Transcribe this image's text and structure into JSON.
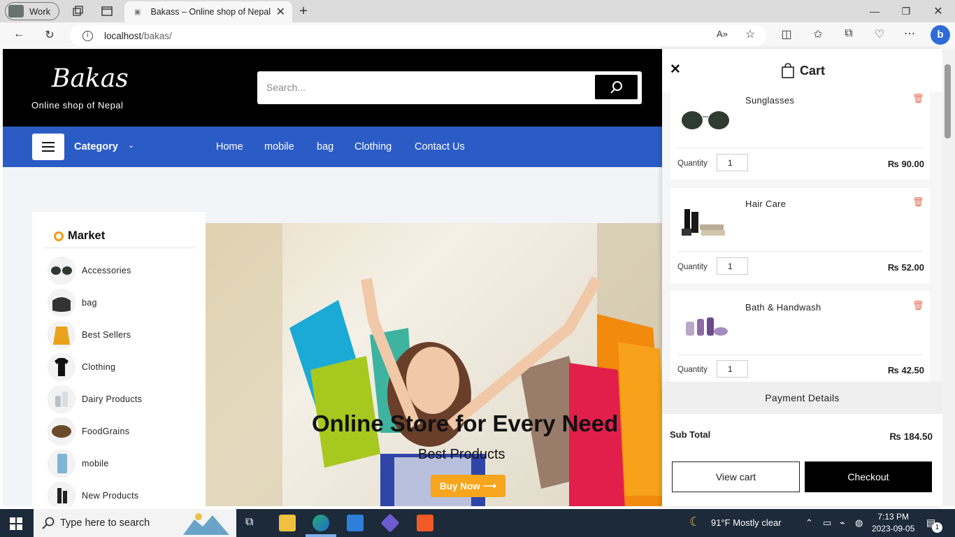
{
  "browser": {
    "profile_label": "Work",
    "tab_title": "Bakass – Online shop of Nepal",
    "url_host": "localhost",
    "url_path": "/bakas/"
  },
  "site": {
    "logo": "Bakas",
    "tagline": "Online shop of Nepal",
    "search_placeholder": "Search...",
    "category_label": "Category",
    "nav": [
      "Home",
      "mobile",
      "bag",
      "Clothing",
      "Contact Us"
    ]
  },
  "market": {
    "title": "Market",
    "items": [
      "Accessories",
      "bag",
      "Best Sellers",
      "Clothing",
      "Dairy Products",
      "FoodGrains",
      "mobile",
      "New Products"
    ]
  },
  "hero": {
    "title": "Online Store for Every Need",
    "subtitle": "Best Products",
    "button": "Buy Now"
  },
  "cart": {
    "title": "Cart",
    "quantity_label": "Quantity",
    "items": [
      {
        "name": "Sunglasses",
        "qty": "1",
        "price": "₨ 90.00"
      },
      {
        "name": "Hair Care",
        "qty": "1",
        "price": "₨ 52.00"
      },
      {
        "name": "Bath & Handwash",
        "qty": "1",
        "price": "₨ 42.50"
      }
    ],
    "payment_details": "Payment Details",
    "subtotal_label": "Sub Total",
    "subtotal_value": "₨ 184.50",
    "view_cart": "View cart",
    "checkout": "Checkout"
  },
  "taskbar": {
    "search_text": "Type here to search",
    "weather": "91°F  Mostly clear",
    "time": "7:13 PM",
    "date": "2023-09-05",
    "notification_count": "1"
  },
  "colors": {
    "nav_blue": "#2b5cc6",
    "accent_orange": "#f7a51c",
    "trash_red": "#e36b52",
    "taskbar": "#1c2a3a"
  }
}
